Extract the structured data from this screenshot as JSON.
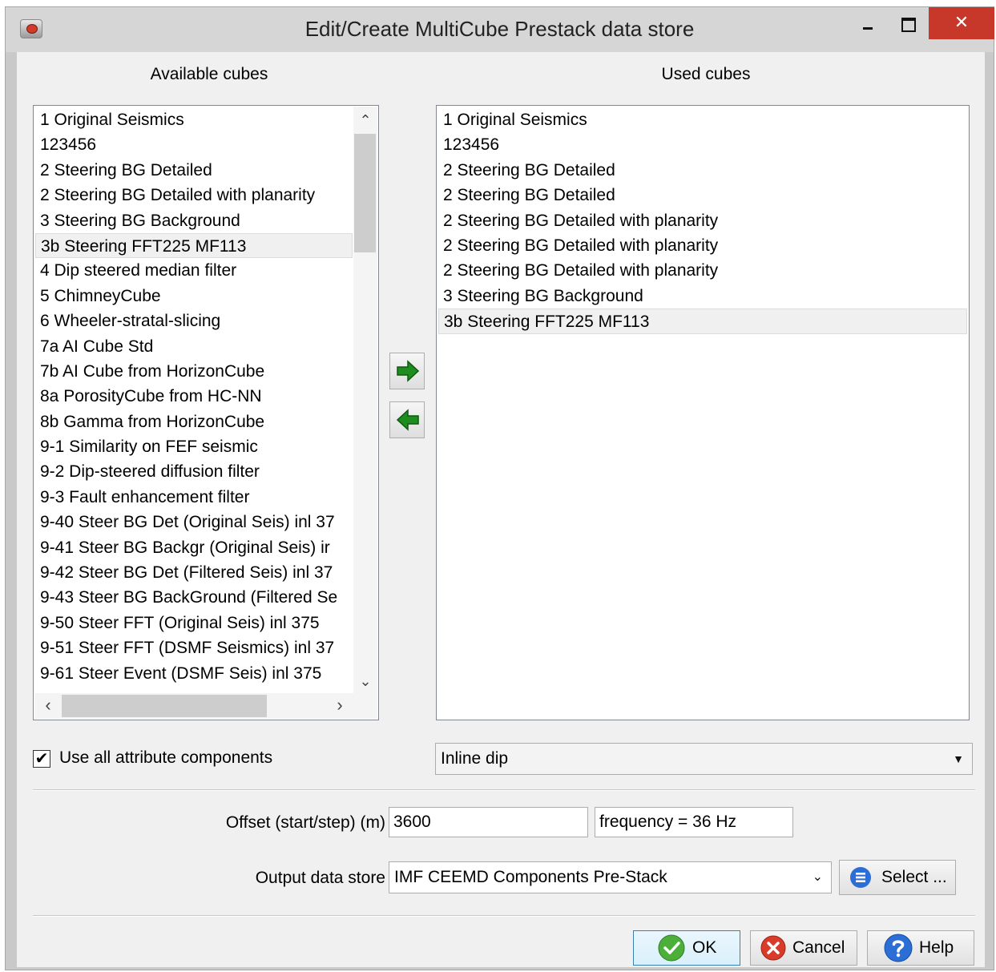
{
  "window": {
    "title": "Edit/Create MultiCube Prestack data store",
    "close_glyph": "✕",
    "icons": {
      "app": "app-icon",
      "minimize": "minimize-icon",
      "maximize": "maximize-icon",
      "close": "close-icon"
    }
  },
  "available": {
    "header": "Available cubes",
    "items": [
      "1 Original Seismics",
      "123456",
      "2 Steering BG Detailed",
      "2 Steering BG Detailed with planarity",
      "3 Steering BG Background",
      "3b Steering FFT225 MF113",
      "4 Dip steered median filter",
      "5 ChimneyCube",
      "6 Wheeler-stratal-slicing",
      "7a AI Cube Std",
      "7b AI Cube from HorizonCube",
      "8a PorosityCube from HC-NN",
      "8b Gamma from HorizonCube",
      "9-1 Similarity on FEF seismic",
      "9-2 Dip-steered diffusion filter",
      "9-3 Fault enhancement filter",
      "9-40 Steer BG Det (Original Seis) inl 37",
      "9-41 Steer BG Backgr (Original Seis) ir",
      "9-42 Steer BG Det (Filtered Seis) inl 37",
      "9-43 Steer BG BackGround (Filtered Se",
      "9-50 Steer FFT (Original Seis) inl 375",
      "9-51 Steer FFT (DSMF Seismics) inl 37",
      "9-61 Steer Event (DSMF Seis) inl 375"
    ],
    "selected_index": 5,
    "vertical_scroll_position": 0.0
  },
  "used": {
    "header": "Used cubes",
    "items": [
      "1 Original Seismics",
      "123456",
      "2 Steering BG Detailed",
      "2 Steering BG Detailed",
      "2 Steering BG Detailed with planarity",
      "2 Steering BG Detailed with planarity",
      "2 Steering BG Detailed with planarity",
      "3 Steering BG Background",
      "3b Steering FFT225 MF113"
    ],
    "selected_index": 8
  },
  "move_buttons": {
    "add_icon": "arrow-right-icon",
    "remove_icon": "arrow-left-icon"
  },
  "use_all_components": {
    "checked": true,
    "label": "Use all attribute components",
    "check_glyph": "✔"
  },
  "component_select": {
    "value": "Inline dip"
  },
  "offset": {
    "label": "Offset (start/step) (m)",
    "start": "3600",
    "step": "frequency = 36 Hz"
  },
  "output": {
    "label": "Output data store",
    "value": "IMF CEEMD Components Pre-Stack",
    "select_label": "Select ..."
  },
  "buttons": {
    "ok": "OK",
    "cancel": "Cancel",
    "help": "Help"
  },
  "glyphs": {
    "up": "⌃",
    "down": "⌄",
    "left": "‹",
    "right": "›",
    "dropdown": "▼",
    "combo_caret": "⌄"
  },
  "colors": {
    "close_button": "#c7372a",
    "arrow_green": "#1e8c1e",
    "ok_green": "#4caf3a",
    "cancel_red": "#d93a2a",
    "help_blue": "#2b6fd6"
  }
}
